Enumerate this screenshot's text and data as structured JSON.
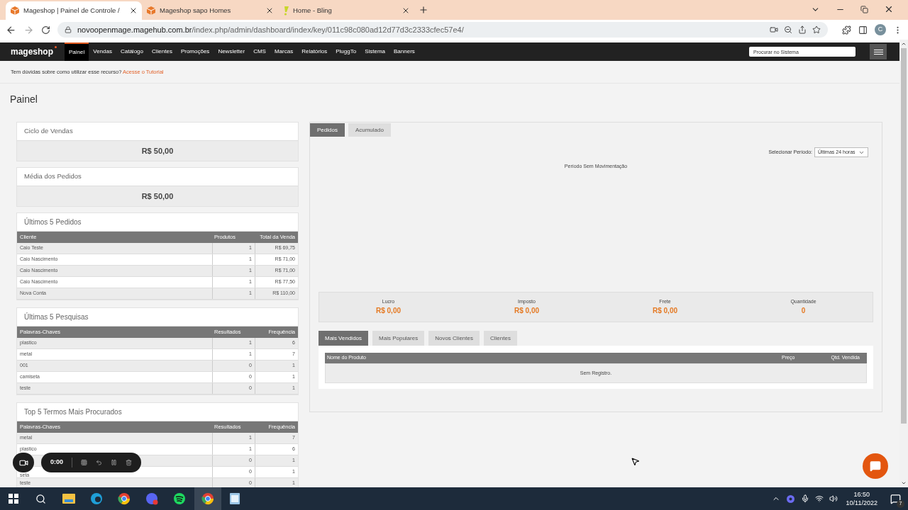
{
  "browser": {
    "tabs": [
      {
        "title": "Mageshop | Painel de Controle /",
        "selected": true,
        "kind": "box"
      },
      {
        "title": "Mageshop sapo Homes",
        "selected": false,
        "kind": "box"
      },
      {
        "title": "Home - Bling",
        "selected": false,
        "kind": "bling"
      }
    ],
    "url_host": "novoopenmage.magehub.com.br",
    "url_path": "/index.php/admin/dashboard/index/key/011c98c080ad12d77d3c2333cfec57e4/",
    "profile": "C"
  },
  "nav": {
    "logo": "mageshop",
    "items": [
      {
        "label": "Painel",
        "selected": true
      },
      {
        "label": "Vendas",
        "selected": false
      },
      {
        "label": "Catálogo",
        "selected": false
      },
      {
        "label": "Clientes",
        "selected": false
      },
      {
        "label": "Promoções",
        "selected": false
      },
      {
        "label": "Newsletter",
        "selected": false
      },
      {
        "label": "CMS",
        "selected": false
      },
      {
        "label": "Marcas",
        "selected": false
      },
      {
        "label": "Relatórios",
        "selected": false
      },
      {
        "label": "PluggTo",
        "selected": false
      },
      {
        "label": "Sistema",
        "selected": false
      },
      {
        "label": "Banners",
        "selected": false
      }
    ],
    "search_placeholder": "Procurar no Sistema"
  },
  "help": {
    "text": "Tem dúvidas sobre como utilizar esse recurso?",
    "link": "Acesse o Tutorial"
  },
  "page_title": "Painel",
  "summaries": [
    {
      "title": "Ciclo de Vendas",
      "value": "R$ 50,00"
    },
    {
      "title": "Média dos Pedidos",
      "value": "R$ 50,00"
    }
  ],
  "tables": [
    {
      "title": "Últimos 5 Pedidos",
      "columns": [
        "Cliente",
        "Produtos",
        "Total da Venda"
      ],
      "rows": [
        [
          "Caio Teste",
          "1",
          "R$ 69,75"
        ],
        [
          "Caio Nascimento",
          "1",
          "R$ 71,00"
        ],
        [
          "Caio Nascimento",
          "1",
          "R$ 71,00"
        ],
        [
          "Caio Nascimento",
          "1",
          "R$ 77,50"
        ],
        [
          "Nova Conta",
          "1",
          "R$ 110,00"
        ]
      ]
    },
    {
      "title": "Últimas 5 Pesquisas",
      "columns": [
        "Palavras-Chaves",
        "Resultados",
        "Frequência"
      ],
      "rows": [
        [
          "plastico",
          "1",
          "6"
        ],
        [
          "metal",
          "1",
          "7"
        ],
        [
          "001",
          "0",
          "1"
        ],
        [
          "camiseta",
          "0",
          "1"
        ],
        [
          "teste",
          "0",
          "1"
        ]
      ]
    },
    {
      "title": "Top 5 Termos Mais Procurados",
      "columns": [
        "Palavras-Chaves",
        "Resultados",
        "Frequência"
      ],
      "rows": [
        [
          "metal",
          "1",
          "7"
        ],
        [
          "plastico",
          "1",
          "6"
        ],
        [
          null,
          "0",
          "1"
        ],
        [
          "seta",
          "0",
          "1"
        ],
        [
          "teste",
          "0",
          "1"
        ]
      ]
    }
  ],
  "chart_panel": {
    "tabs": [
      {
        "label": "Pedidos",
        "selected": true
      },
      {
        "label": "Acumulado",
        "selected": false
      }
    ],
    "period_label": "Selecionar Período:",
    "period_value": "Últimas 24 horas",
    "empty_message": "Período Sem Movimentação",
    "totals": [
      {
        "label": "Lucro",
        "value": "R$ 0,00"
      },
      {
        "label": "Imposto",
        "value": "R$ 0,00"
      },
      {
        "label": "Frete",
        "value": "R$ 0,00"
      },
      {
        "label": "Quantidade",
        "value": "0"
      }
    ],
    "list_tabs": [
      {
        "label": "Mais Vendidos",
        "selected": true
      },
      {
        "label": "Mais Populares",
        "selected": false
      },
      {
        "label": "Novos Clientes",
        "selected": false
      },
      {
        "label": "Clientes",
        "selected": false
      }
    ],
    "list_columns": [
      "Nome do Produto",
      "Preço",
      "Qtd. Vendida"
    ],
    "list_empty": "Sem Registro."
  },
  "recorder": {
    "time": "0:00"
  },
  "taskbar": {
    "time": "16:50",
    "date": "10/11/2022",
    "notifications": "7"
  }
}
